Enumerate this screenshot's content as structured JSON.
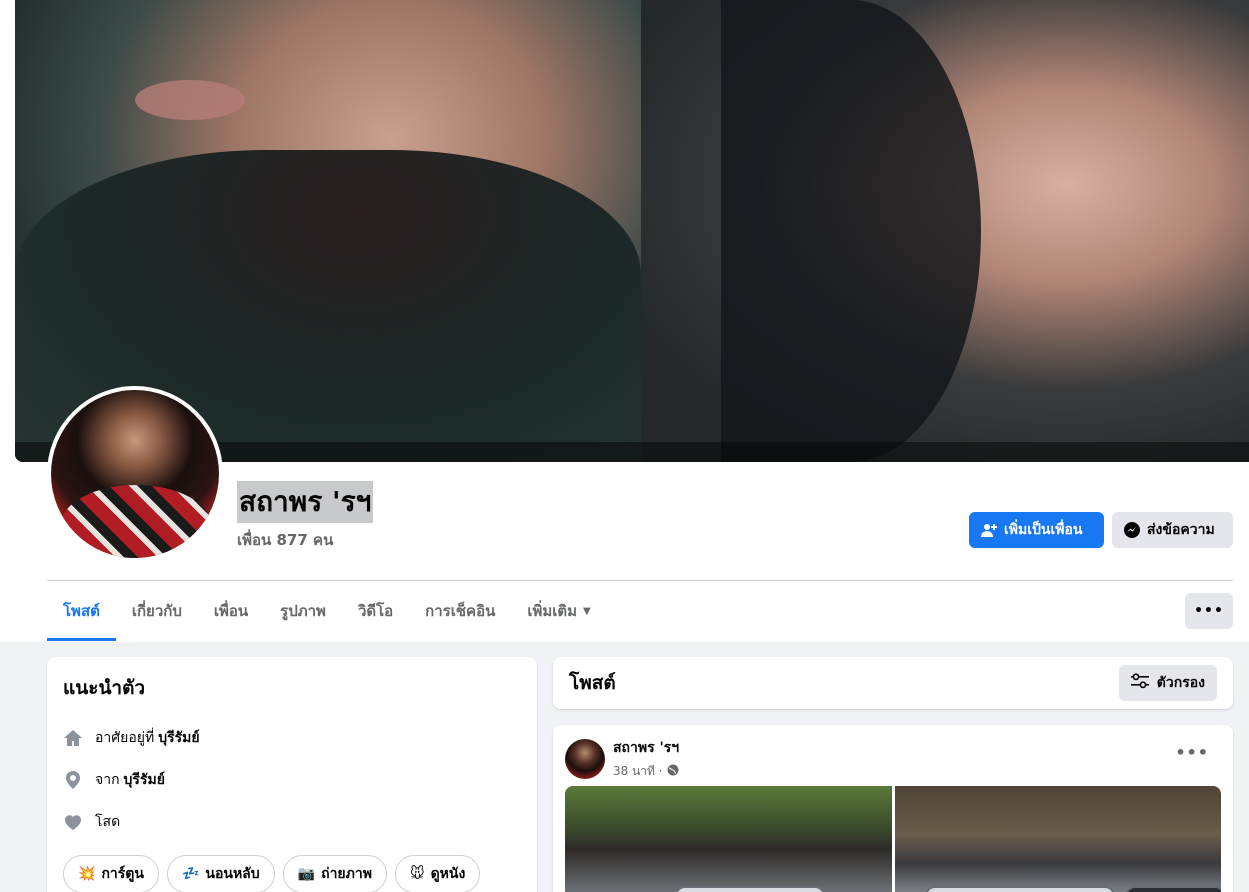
{
  "profile": {
    "name": "สถาพร 'รฯ",
    "friends": "เพื่อน 877 คน"
  },
  "actions": {
    "add_friend": "เพิ่มเป็นเพื่อน",
    "message": "ส่งข้อความ",
    "more": "•••"
  },
  "tabs": [
    {
      "label": "โพสต์"
    },
    {
      "label": "เกี่ยวกับ"
    },
    {
      "label": "เพื่อน"
    },
    {
      "label": "รูปภาพ"
    },
    {
      "label": "วิดีโอ"
    },
    {
      "label": "การเช็คอิน"
    },
    {
      "label": "เพิ่มเติม"
    }
  ],
  "intro": {
    "title": "แนะนำตัว",
    "lives_prefix": "อาศัยอยู่ที่",
    "lives_place": "บุรีรัมย์",
    "from_prefix": "จาก",
    "from_place": "บุรีรัมย์",
    "relationship": "โสด",
    "hobbies": [
      {
        "icon": "💥",
        "label": "การ์ตูน"
      },
      {
        "icon": "💤",
        "label": "นอนหลับ"
      },
      {
        "icon": "📷",
        "label": "ถ่ายภาพ"
      },
      {
        "icon": "🐭",
        "label": "ดูหนัง"
      }
    ]
  },
  "posts": {
    "title": "โพสต์",
    "filter": "ตัวกรอง",
    "post": {
      "author": "สถาพร 'รฯ",
      "time": "38 นาที ·"
    }
  },
  "colors": {
    "primary": "#1877f2",
    "secondary_bg": "#e4e6eb",
    "page_bg": "#f0f2f5"
  }
}
